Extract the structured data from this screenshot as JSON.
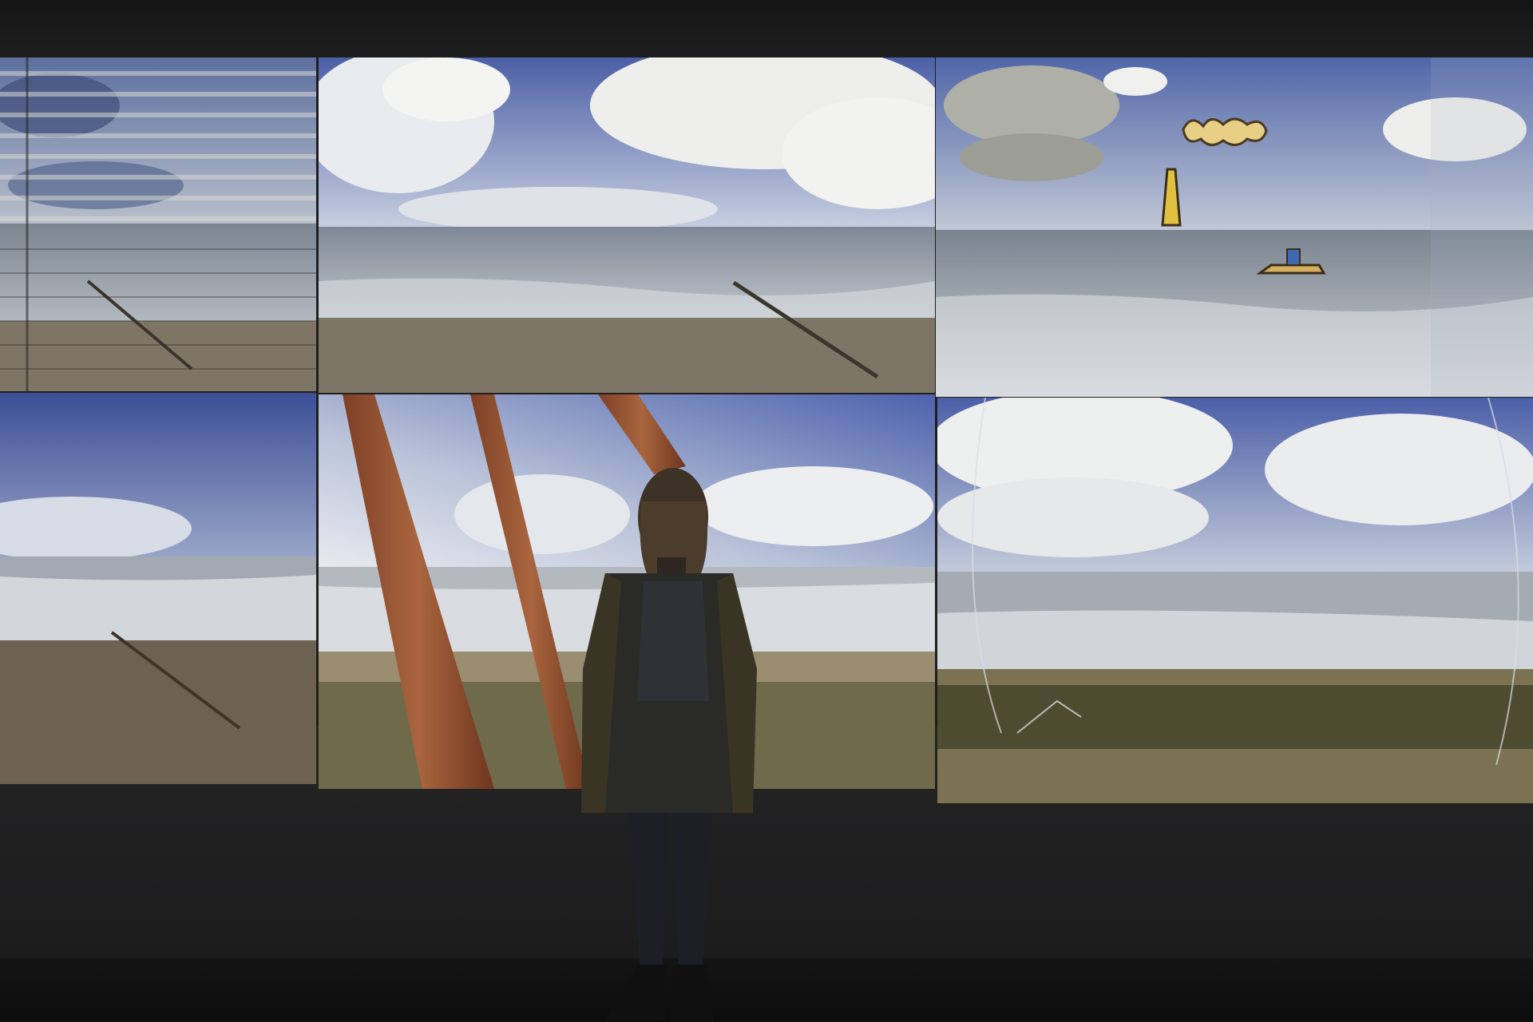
{
  "scene": {
    "panels": [
      {
        "name": "panel-top-left-blinds"
      },
      {
        "name": "panel-top-center-sea"
      },
      {
        "name": "panel-top-right-drawings"
      },
      {
        "name": "panel-bottom-left-sea"
      },
      {
        "name": "panel-bottom-center-sculpture"
      },
      {
        "name": "panel-bottom-right-glass"
      }
    ],
    "colors": {
      "sky_deep": "#4d62a8",
      "sky_light": "#c9d3e6",
      "cloud": "#f2f2f0",
      "sea": "#8e97a3",
      "foam": "#d9dde2",
      "sand": "#8a7d6a",
      "rust": "#9b5a3a",
      "wall": "#1f1f20"
    }
  }
}
